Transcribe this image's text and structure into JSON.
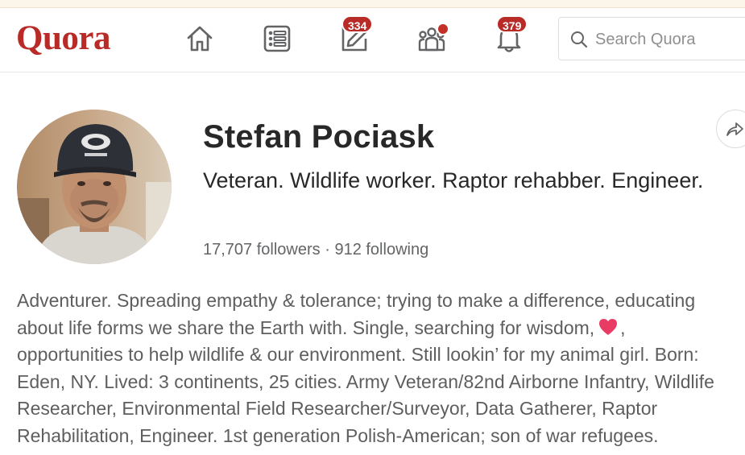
{
  "app": {
    "logo": "Quora",
    "brand_color": "#b92b27"
  },
  "nav": {
    "items": [
      {
        "name": "home",
        "icon": "home-icon"
      },
      {
        "name": "following",
        "icon": "following-list-icon"
      },
      {
        "name": "answer",
        "icon": "pencil-square-icon",
        "badge": "334"
      },
      {
        "name": "spaces",
        "icon": "people-group-icon",
        "dot": true
      },
      {
        "name": "notifications",
        "icon": "bell-icon",
        "badge": "379"
      }
    ]
  },
  "search": {
    "placeholder": "Search Quora",
    "icon": "search-icon"
  },
  "profile": {
    "name": "Stefan Pociask",
    "tagline": "Veteran. Wildlife worker. Raptor rehabber. Engineer.",
    "followers": "17,707 followers",
    "separator": "·",
    "following": "912 following",
    "share_icon": "share-arrow-icon",
    "bio_lines": [
      "Adventurer. Spreading empathy & tolerance; trying to make a difference, educating",
      "about life forms we share the Earth with. Single, searching for wisdom,",
      ",",
      "opportunities to help wildlife & our environment. Still lookin’ for my animal girl. Born:",
      "Eden, NY. Lived: 3 continents, 25 cities. Army Veteran/82nd Airborne Infantry, Wildlife",
      "Researcher, Environmental Field Researcher/Surveyor, Data Gatherer, Raptor",
      "Rehabilitation, Engineer. 1st generation Polish-American; son of war refugees."
    ],
    "bio_heart_icon": "heart-icon"
  }
}
